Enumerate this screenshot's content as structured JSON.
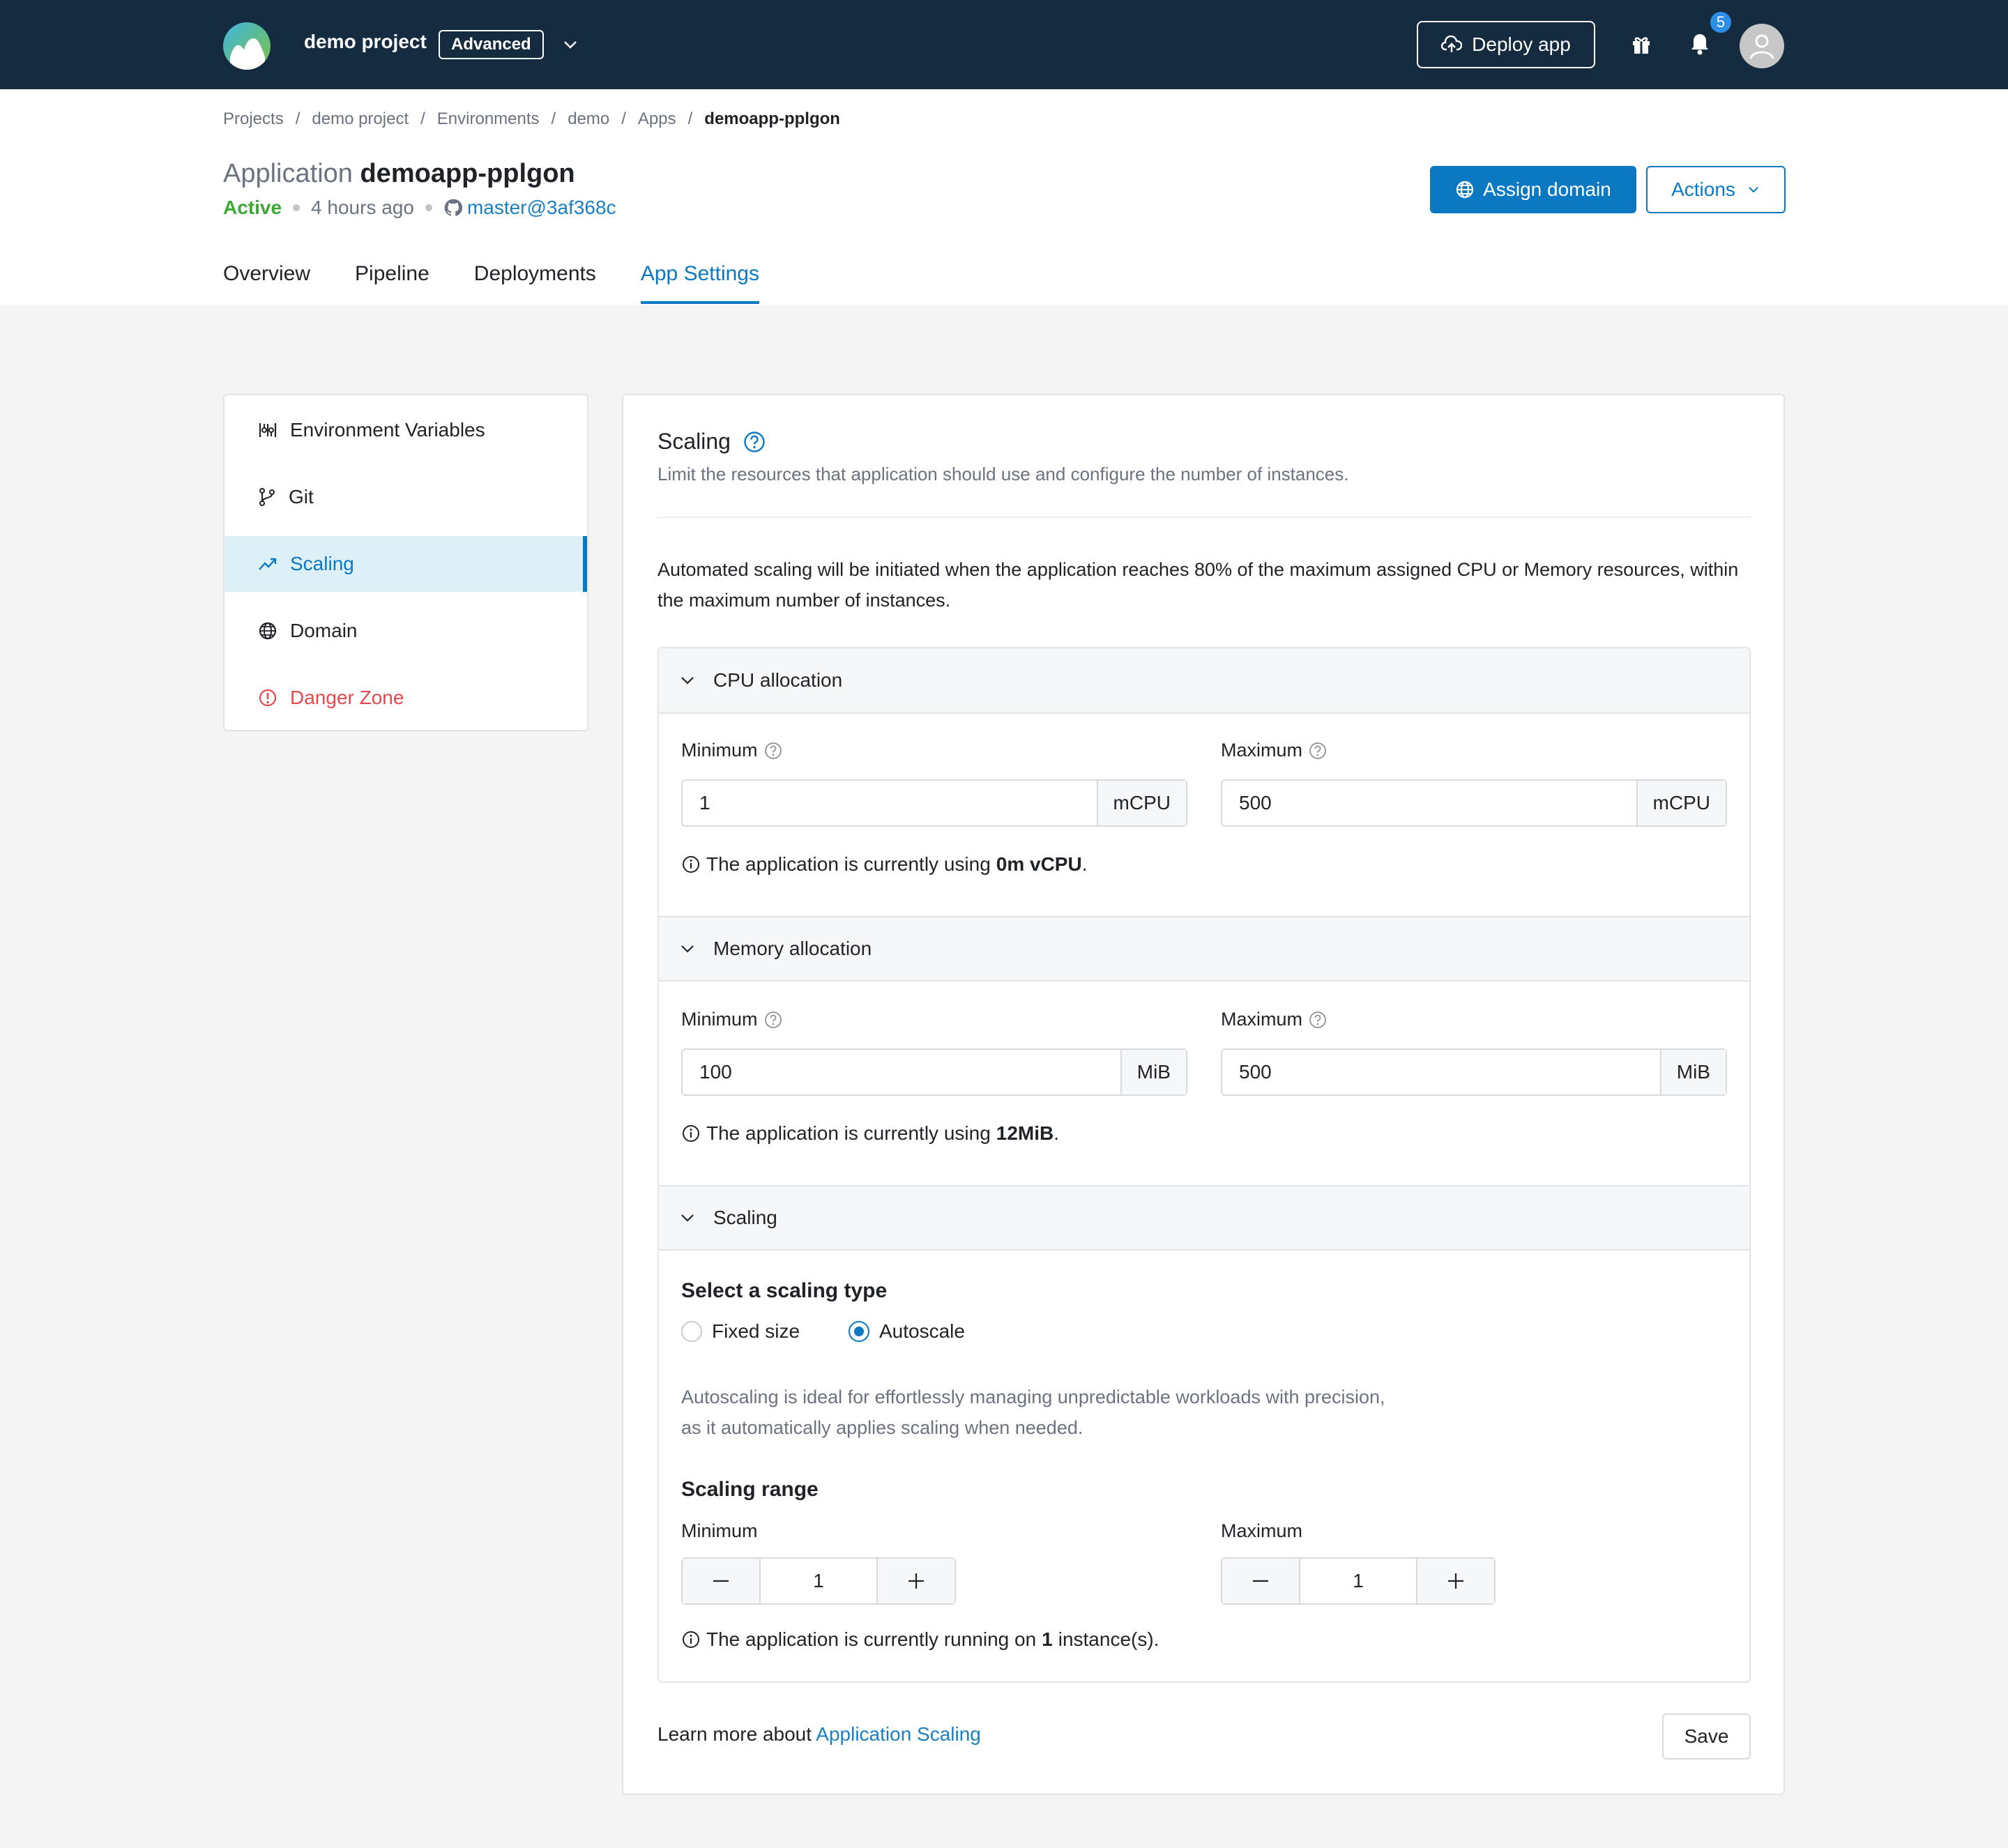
{
  "topbar": {
    "project_name": "demo project",
    "tier": "Advanced",
    "deploy_label": "Deploy app",
    "notification_count": "5"
  },
  "breadcrumb": [
    "Projects",
    "demo project",
    "Environments",
    "demo",
    "Apps",
    "demoapp-pplgon"
  ],
  "app": {
    "title_prefix": "Application",
    "name": "demoapp-pplgon",
    "status": "Active",
    "updated": "4 hours ago",
    "branch": "master@3af368c"
  },
  "header_actions": {
    "assign_domain": "Assign domain",
    "actions": "Actions"
  },
  "tabs": [
    "Overview",
    "Pipeline",
    "Deployments",
    "App Settings"
  ],
  "sidebar": {
    "items": [
      {
        "label": "Environment Variables"
      },
      {
        "label": "Git"
      },
      {
        "label": "Scaling"
      },
      {
        "label": "Domain"
      },
      {
        "label": "Danger Zone"
      }
    ]
  },
  "scaling": {
    "title": "Scaling",
    "subtitle": "Limit the resources that application should use and configure the number of instances.",
    "intro": "Automated scaling will be initiated when the application reaches 80% of the maximum assigned CPU or Memory resources, within the maximum number of instances.",
    "cpu": {
      "heading": "CPU allocation",
      "min_label": "Minimum",
      "max_label": "Maximum",
      "min_value": "1",
      "max_value": "500",
      "unit": "mCPU",
      "usage_prefix": "The application is currently using",
      "usage_value": "0m vCPU",
      "usage_suffix": "."
    },
    "memory": {
      "heading": "Memory allocation",
      "min_label": "Minimum",
      "max_label": "Maximum",
      "min_value": "100",
      "max_value": "500",
      "unit": "MiB",
      "usage_prefix": "The application is currently using",
      "usage_value": "12MiB",
      "usage_suffix": "."
    },
    "instances": {
      "heading": "Scaling",
      "type_heading": "Select a scaling type",
      "option_fixed": "Fixed size",
      "option_auto": "Autoscale",
      "selected": "Autoscale",
      "desc_line1": "Autoscaling is ideal for effortlessly managing unpredictable workloads with precision,",
      "desc_line2": "as it automatically applies scaling when needed.",
      "range_heading": "Scaling range",
      "min_label": "Minimum",
      "max_label": "Maximum",
      "min_value": "1",
      "max_value": "1",
      "running_prefix": "The application is currently running on",
      "running_value": "1",
      "running_suffix": "instance(s)."
    },
    "learn_prefix": "Learn more about",
    "learn_link": "Application Scaling",
    "save": "Save"
  },
  "colors": {
    "topbar": "#142b40",
    "accent": "#0b78c2",
    "active_status": "#3aaa35",
    "danger": "#e5484d"
  }
}
